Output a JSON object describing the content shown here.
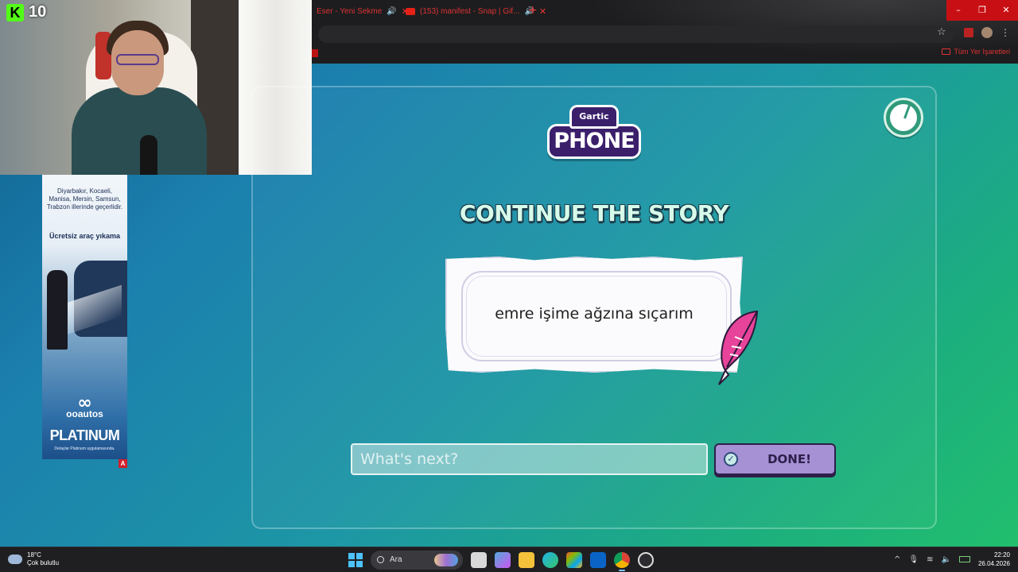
{
  "stream": {
    "kick_logo": "K",
    "viewer_count": "10"
  },
  "browser": {
    "tabs": [
      {
        "title": "Eser - Yeni Sekme",
        "audio_icon": "speaker-icon"
      },
      {
        "title": "(153) manifest - Snap | Gif...",
        "audio_icon": "speaker-icon"
      }
    ],
    "bookmark_folder": "Tüm Yer İşaretleri",
    "window_controls": [
      "–",
      "❐",
      "✕"
    ]
  },
  "ad": {
    "cities": "Diyarbakır, Kocaeli, Manisa, Mersin, Samsun, Trabzon illerinde geçerlidir.",
    "offer": "Ücretsiz araç yıkama",
    "brand": "ooautos",
    "tier": "PLATINUM",
    "footer": "Detaylar Platinum uygulamasında.",
    "badge": "A"
  },
  "game": {
    "logo_top": "Gartic",
    "logo_bottom": "PHONE",
    "heading": "CONTINUE THE STORY",
    "story_text": "emre işime ağzına sıçarım",
    "input_placeholder": "What's next?",
    "input_value": "",
    "done_label": "DONE!",
    "timer_fraction_remaining": 0.94,
    "colors": {
      "accent_purple": "#a591d4",
      "heading_mint": "#d7fbea",
      "dark_outline": "#1b3b4a"
    }
  },
  "taskbar": {
    "weather_temp": "18°C",
    "weather_desc": "Çok bulutlu",
    "search_label": "Ara",
    "time": "22:20",
    "date": "26.04.2026"
  }
}
